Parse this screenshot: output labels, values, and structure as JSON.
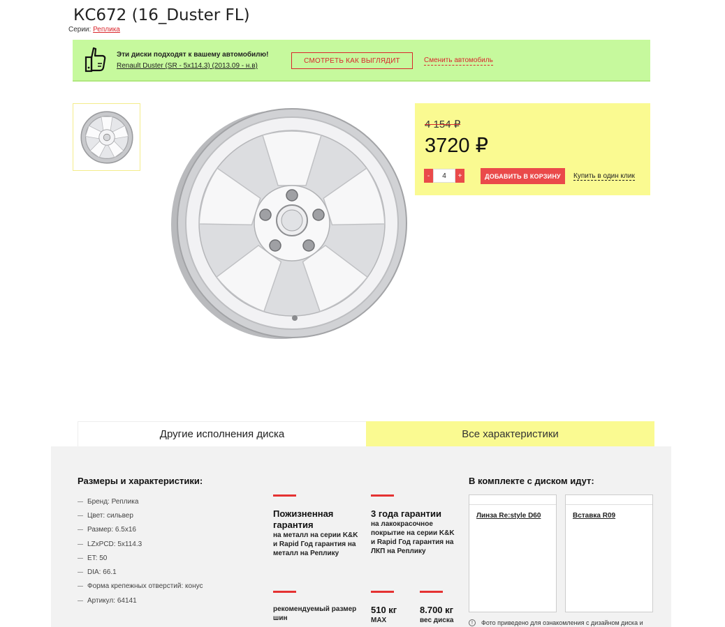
{
  "product": {
    "title": "КС672 (16_Duster FL)",
    "series_label": "Серии:",
    "series_link": "Реплика"
  },
  "fit": {
    "message": "Эти диски подходят к вашему автомобилю!",
    "car": "Renault Duster (SR - 5x114.3) (2013.09 - н.в)",
    "look_button": "СМОТРЕТЬ КАК ВЫГЛЯДИТ",
    "change_link": "Сменить автомобиль",
    "icon": "thumbs-up-icon"
  },
  "price": {
    "old": "4 154 ₽",
    "new": "3720 ₽",
    "qty_minus": "-",
    "qty_value": "4",
    "qty_plus": "+",
    "cart_button": "ДОБАВИТЬ В КОРЗИНУ",
    "one_click": "Купить в один клик"
  },
  "tabs": [
    {
      "label": "Другие исполнения диска",
      "active": false
    },
    {
      "label": "Все характеристики",
      "active": true
    }
  ],
  "specs": {
    "title": "Размеры и характеристики:",
    "items": [
      "Бренд: Реплика",
      "Цвет: сильвер",
      "Размер: 6.5x16",
      "LZxPCD: 5x114.3",
      "ET: 50",
      "DIA: 66.1",
      "Форма крепежных отверстий: конус",
      "Артикул: 64141"
    ]
  },
  "features": {
    "f1_title": "Пожизненная гарантия",
    "f1_text": "на металл на серии K&K и Rapid Год гарантия на металл на Реплику",
    "f2_title": "3 года гарантии",
    "f2_text": "на лакокрасочное покрытие на серии K&K и Rapid Год гарантия на ЛКП на Реплику",
    "f3_text": "рекомендуемый размер шин",
    "f4_title": "510 кг",
    "f4_text": "MAX",
    "f5_title": "8.700 кг",
    "f5_text": "вес диска"
  },
  "kit": {
    "title": "В комплекте с диском идут:",
    "items": [
      "Линза Re:style D60",
      "Вставка R09"
    ],
    "note": "Фото приведено для ознакомления с дизайном диска и"
  },
  "colors": {
    "accent_red": "#e53232",
    "fit_green": "#c6f99d",
    "highlight_yellow": "#fafa91"
  }
}
